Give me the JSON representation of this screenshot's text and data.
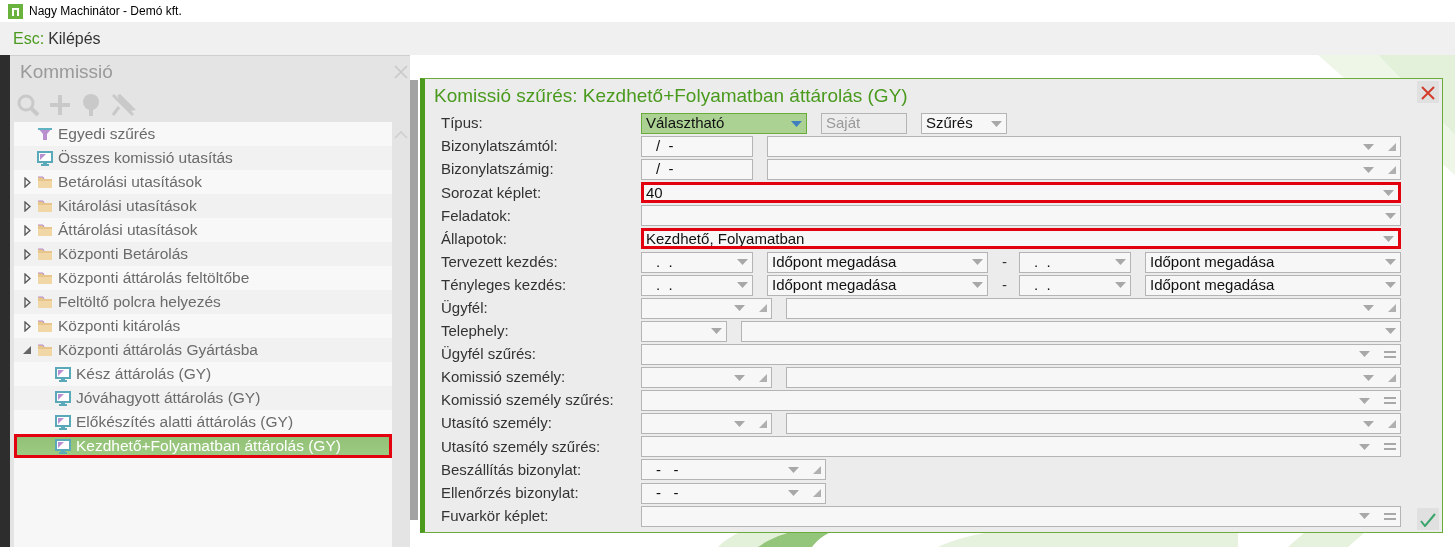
{
  "window": {
    "title": "Nagy Machinátor - Demó kft."
  },
  "menu_bar": {
    "shortcut_key": "Esc:",
    "shortcut_label": "Kilépés"
  },
  "sidebar": {
    "title": "Kommissió",
    "tree": [
      {
        "kind": "filter",
        "label": "Egyedi szűrés",
        "selected": false
      },
      {
        "kind": "monitor",
        "label": "Összes komissió utasítás",
        "selected": false
      },
      {
        "kind": "folder",
        "label": "Betárolási utasítások",
        "expanded": false,
        "selected": false
      },
      {
        "kind": "folder",
        "label": "Kitárolási utasítások",
        "expanded": false,
        "selected": false
      },
      {
        "kind": "folder",
        "label": "Áttárolási utasítások",
        "expanded": false,
        "selected": false
      },
      {
        "kind": "folder",
        "label": "Központi Betárolás",
        "expanded": false,
        "selected": false
      },
      {
        "kind": "folder",
        "label": "Központi áttárolás feltöltőbe",
        "expanded": false,
        "selected": false
      },
      {
        "kind": "folder",
        "label": "Feltöltő polcra helyezés",
        "expanded": false,
        "selected": false
      },
      {
        "kind": "folder",
        "label": "Központi kitárolás",
        "expanded": false,
        "selected": false
      },
      {
        "kind": "folder",
        "label": "Központi áttárolás Gyártásba",
        "expanded": true,
        "selected": false,
        "children": [
          {
            "kind": "monitor",
            "label": "Kész áttárolás (GY)",
            "selected": false
          },
          {
            "kind": "monitor",
            "label": "Jóváhagyott áttárolás (GY)",
            "selected": false
          },
          {
            "kind": "monitor",
            "label": "Előkészítés alatti áttárolás (GY)",
            "selected": false
          },
          {
            "kind": "monitor",
            "label": "Kezdhető+Folyamatban áttárolás (GY)",
            "selected": true
          }
        ]
      }
    ]
  },
  "dialog": {
    "title": "Komissió szűrés: Kezdhető+Folyamatban áttárolás (GY)",
    "rows": [
      {
        "label": "Típus:",
        "highlighted": false,
        "fields": [
          {
            "kind": "type-select",
            "value": "Választható"
          },
          {
            "kind": "readonly",
            "value": "Saját"
          },
          {
            "kind": "filter-select",
            "value": "Szűrés"
          }
        ]
      },
      {
        "label": "Bizonylatszámtól:",
        "highlighted": false,
        "fields": [
          {
            "kind": "number",
            "value": "/  -"
          },
          {
            "kind": "lookup"
          }
        ]
      },
      {
        "label": "Bizonylatszámig:",
        "highlighted": false,
        "fields": [
          {
            "kind": "number",
            "value": "/  -"
          },
          {
            "kind": "lookup"
          }
        ]
      },
      {
        "label": "Sorozat képlet:",
        "highlighted": true,
        "fields": [
          {
            "kind": "combo",
            "value": "40"
          }
        ]
      },
      {
        "label": "Feladatok:",
        "highlighted": false,
        "fields": [
          {
            "kind": "combo"
          }
        ]
      },
      {
        "label": "Állapotok:",
        "highlighted": true,
        "fields": [
          {
            "kind": "combo",
            "value": "Kezdhető, Folyamatban"
          }
        ]
      },
      {
        "label": "Tervezett kezdés:",
        "highlighted": false,
        "fields": [
          {
            "kind": "date",
            "value": ".  ."
          },
          {
            "kind": "time",
            "value": "Időpont megadása"
          },
          {
            "kind": "separator",
            "value": "-"
          },
          {
            "kind": "date",
            "value": ".  ."
          },
          {
            "kind": "time-end",
            "value": "Időpont megadása"
          }
        ]
      },
      {
        "label": "Tényleges kezdés:",
        "highlighted": false,
        "fields": [
          {
            "kind": "date",
            "value": ".  ."
          },
          {
            "kind": "time",
            "value": "Időpont megadása"
          },
          {
            "kind": "separator",
            "value": "-"
          },
          {
            "kind": "date",
            "value": ".  ."
          },
          {
            "kind": "time-end",
            "value": "Időpont megadása"
          }
        ]
      },
      {
        "label": "Ügyfél:",
        "highlighted": false,
        "fields": [
          {
            "kind": "small-lookup"
          },
          {
            "kind": "lookup"
          }
        ]
      },
      {
        "label": "Telephely:",
        "highlighted": false,
        "fields": [
          {
            "kind": "site-select"
          },
          {
            "kind": "combo"
          }
        ]
      },
      {
        "label": "Ügyfél szűrés:",
        "highlighted": false,
        "fields": [
          {
            "kind": "filter-combo"
          }
        ]
      },
      {
        "label": "Komissió személy:",
        "highlighted": false,
        "fields": [
          {
            "kind": "small-lookup"
          },
          {
            "kind": "lookup"
          }
        ]
      },
      {
        "label": "Komissió személy szűrés:",
        "highlighted": false,
        "fields": [
          {
            "kind": "filter-combo"
          }
        ]
      },
      {
        "label": "Utasító személy:",
        "highlighted": false,
        "fields": [
          {
            "kind": "small-lookup"
          },
          {
            "kind": "lookup"
          }
        ]
      },
      {
        "label": "Utasító személy szűrés:",
        "highlighted": false,
        "fields": [
          {
            "kind": "filter-combo"
          }
        ]
      },
      {
        "label": "Beszállítás bizonylat:",
        "highlighted": false,
        "fields": [
          {
            "kind": "doc-lookup",
            "value": "-   -"
          }
        ]
      },
      {
        "label": "Ellenőrzés bizonylat:",
        "highlighted": false,
        "fields": [
          {
            "kind": "doc-lookup",
            "value": "-   -"
          }
        ]
      },
      {
        "label": "Fuvarkör képlet:",
        "highlighted": false,
        "fields": [
          {
            "kind": "filter-combo"
          }
        ]
      }
    ]
  }
}
